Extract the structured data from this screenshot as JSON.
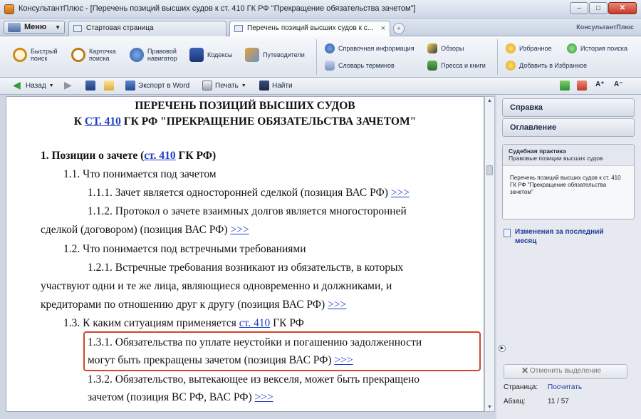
{
  "window": {
    "title": "КонсультантПлюс - [Перечень позиций высших судов к ст. 410 ГК РФ \"Прекращение обязательства зачетом\"]",
    "buttons": [
      "–",
      "□",
      "✕"
    ]
  },
  "tabs": {
    "menu_label": "Меню",
    "items": [
      {
        "label": "Стартовая страница"
      },
      {
        "label": "Перечень позиций высших судов к с..."
      }
    ],
    "add_label": "+",
    "brand": "КонсультантПлюс"
  },
  "ribbon": {
    "quick_search": "Быстрый поиск",
    "card_search": "Карточка поиска",
    "legal_navigator": "Правовой навигатор",
    "codes": "Кодексы",
    "directories": "Путеводители",
    "reference_info": "Справочная информация",
    "term_dictionary": "Словарь терминов",
    "forms": "Обзоры",
    "press": "Пресса и книги",
    "favorites": "Избранное",
    "search_history": "История поиска",
    "add_favorites": "Добавить в Избранное"
  },
  "toolbar": {
    "back": "Назад",
    "export_word": "Экспорт в Word",
    "print": "Печать",
    "find": "Найти"
  },
  "document": {
    "title_line1": "ПЕРЕЧЕНЬ ПОЗИЦИЙ ВЫСШИХ СУДОВ",
    "title_line2_pre": "К ",
    "title_line2_link": "СТ. 410",
    "title_line2_post": " ГК РФ \"ПРЕКРАЩЕНИЕ ОБЯЗАТЕЛЬСТВА ЗАЧЕТОМ\"",
    "s1_pre": "1. Позиции о зачете (",
    "s1_link": "ст. 410",
    "s1_post": " ГК РФ)",
    "s11": "1.1. Что понимается под зачетом",
    "s111": "1.1.1. Зачет является односторонней сделкой (позиция ВАС РФ) ",
    "s112_a": "1.1.2. Протокол о зачете взаимных долгов является многосторонней",
    "s112_b": "сделкой (договором) (позиция ВАС РФ) ",
    "s12": "1.2. Что понимается под встречными требованиями",
    "s121_a": "1.2.1. Встречные требования возникают из обязательств, в которых",
    "s121_b": "участвуют одни и те же лица, являющиеся одновременно и должниками, и",
    "s121_c": "кредиторами по отношению друг к другу (позиция ВАС РФ) ",
    "s13_pre": "1.3. К каким ситуациям применяется ",
    "s13_link": "ст. 410",
    "s13_post": " ГК РФ",
    "s131_a": "1.3.1. Обязательства по уплате неустойки и погашению задолженности",
    "s131_b": "могут быть прекращены зачетом (позиция ВАС РФ) ",
    "s132_a": "1.3.2. Обязательство, вытекающее из векселя, может быть прекращено",
    "s132_b": "зачетом (позиция ВС РФ, ВАС РФ) ",
    "more": ">>>"
  },
  "panel": {
    "help": "Справка",
    "contents": "Оглавление",
    "box_title": "Судебная практика",
    "box_subtitle": "Правовые позиции высших судов",
    "box_text": "Перечень позиций высших судов к ст. 410 ГК РФ \"Прекращение обязательства зачетом\"",
    "changes": "Изменения за последний месяц",
    "cancel": "Отменить выделение",
    "page_label": "Страница:",
    "page_value": "Посчитать",
    "para_label": "Абзац:",
    "para_value": "11 / 57"
  },
  "colors": {
    "link": "#1f3cc8",
    "highlight_border": "#d2462a"
  }
}
